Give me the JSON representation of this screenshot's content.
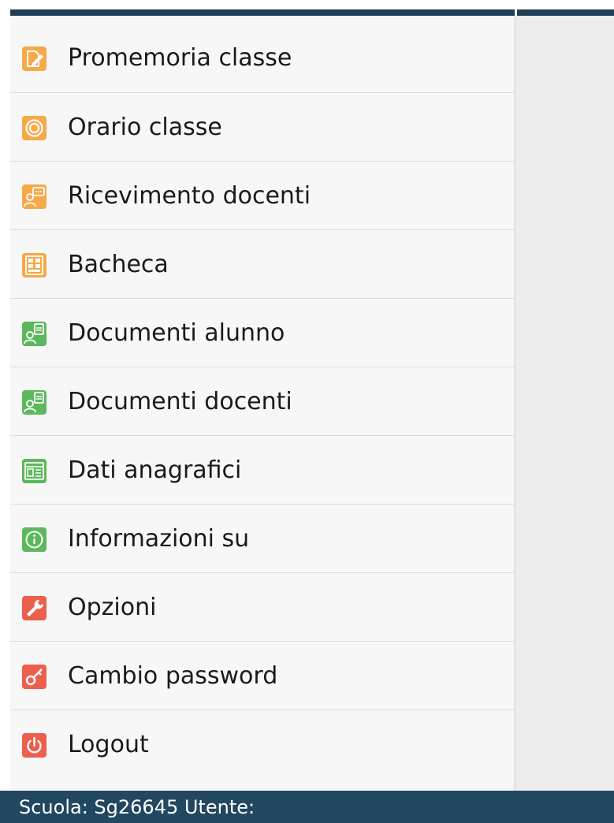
{
  "menu": {
    "items": [
      {
        "label": "Promemoria classe",
        "icon": "note-edit-icon",
        "color": "#f5a947"
      },
      {
        "label": "Orario classe",
        "icon": "target-icon",
        "color": "#f5a947"
      },
      {
        "label": "Ricevimento docenti",
        "icon": "speech-person-icon",
        "color": "#f5a947"
      },
      {
        "label": "Bacheca",
        "icon": "board-icon",
        "color": "#f5a947"
      },
      {
        "label": "Documenti alunno",
        "icon": "person-document-icon",
        "color": "#5cb85c"
      },
      {
        "label": "Documenti docenti",
        "icon": "person-document-icon",
        "color": "#5cb85c"
      },
      {
        "label": "Dati anagrafici",
        "icon": "id-card-icon",
        "color": "#5cb85c"
      },
      {
        "label": "Informazioni su",
        "icon": "info-icon",
        "color": "#5cb85c"
      },
      {
        "label": "Opzioni",
        "icon": "wrench-icon",
        "color": "#ed5f4d"
      },
      {
        "label": "Cambio password",
        "icon": "key-icon",
        "color": "#ed5f4d"
      },
      {
        "label": "Logout",
        "icon": "power-icon",
        "color": "#ed5f4d"
      }
    ]
  },
  "footer": {
    "text": "Scuola: Sg26645 Utente:"
  },
  "colors": {
    "header": "#213e57",
    "footer": "#224760",
    "orange": "#f5a947",
    "green": "#5cb85c",
    "red": "#ed5f4d"
  }
}
